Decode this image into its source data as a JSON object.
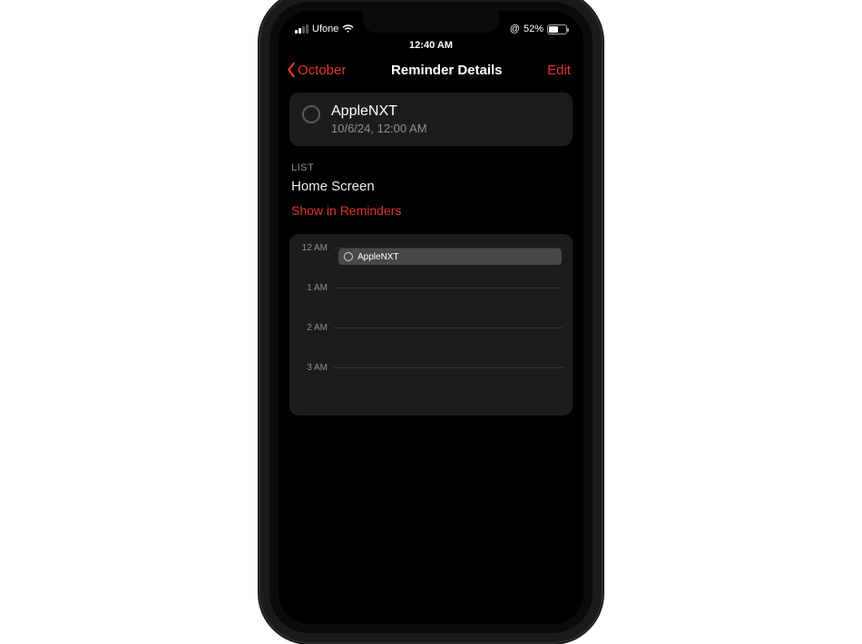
{
  "status": {
    "carrier": "Ufone",
    "time": "12:40 AM",
    "battery_pct": "52%"
  },
  "nav": {
    "back_label": "October",
    "title": "Reminder Details",
    "edit_label": "Edit"
  },
  "reminder": {
    "title": "AppleNXT",
    "datetime": "10/6/24, 12:00 AM"
  },
  "list_section": {
    "header": "LIST",
    "value": "Home Screen",
    "show_link": "Show in Reminders"
  },
  "timeline": {
    "hours": [
      "12 AM",
      "1 AM",
      "2 AM",
      "3 AM"
    ],
    "event_title": "AppleNXT"
  }
}
